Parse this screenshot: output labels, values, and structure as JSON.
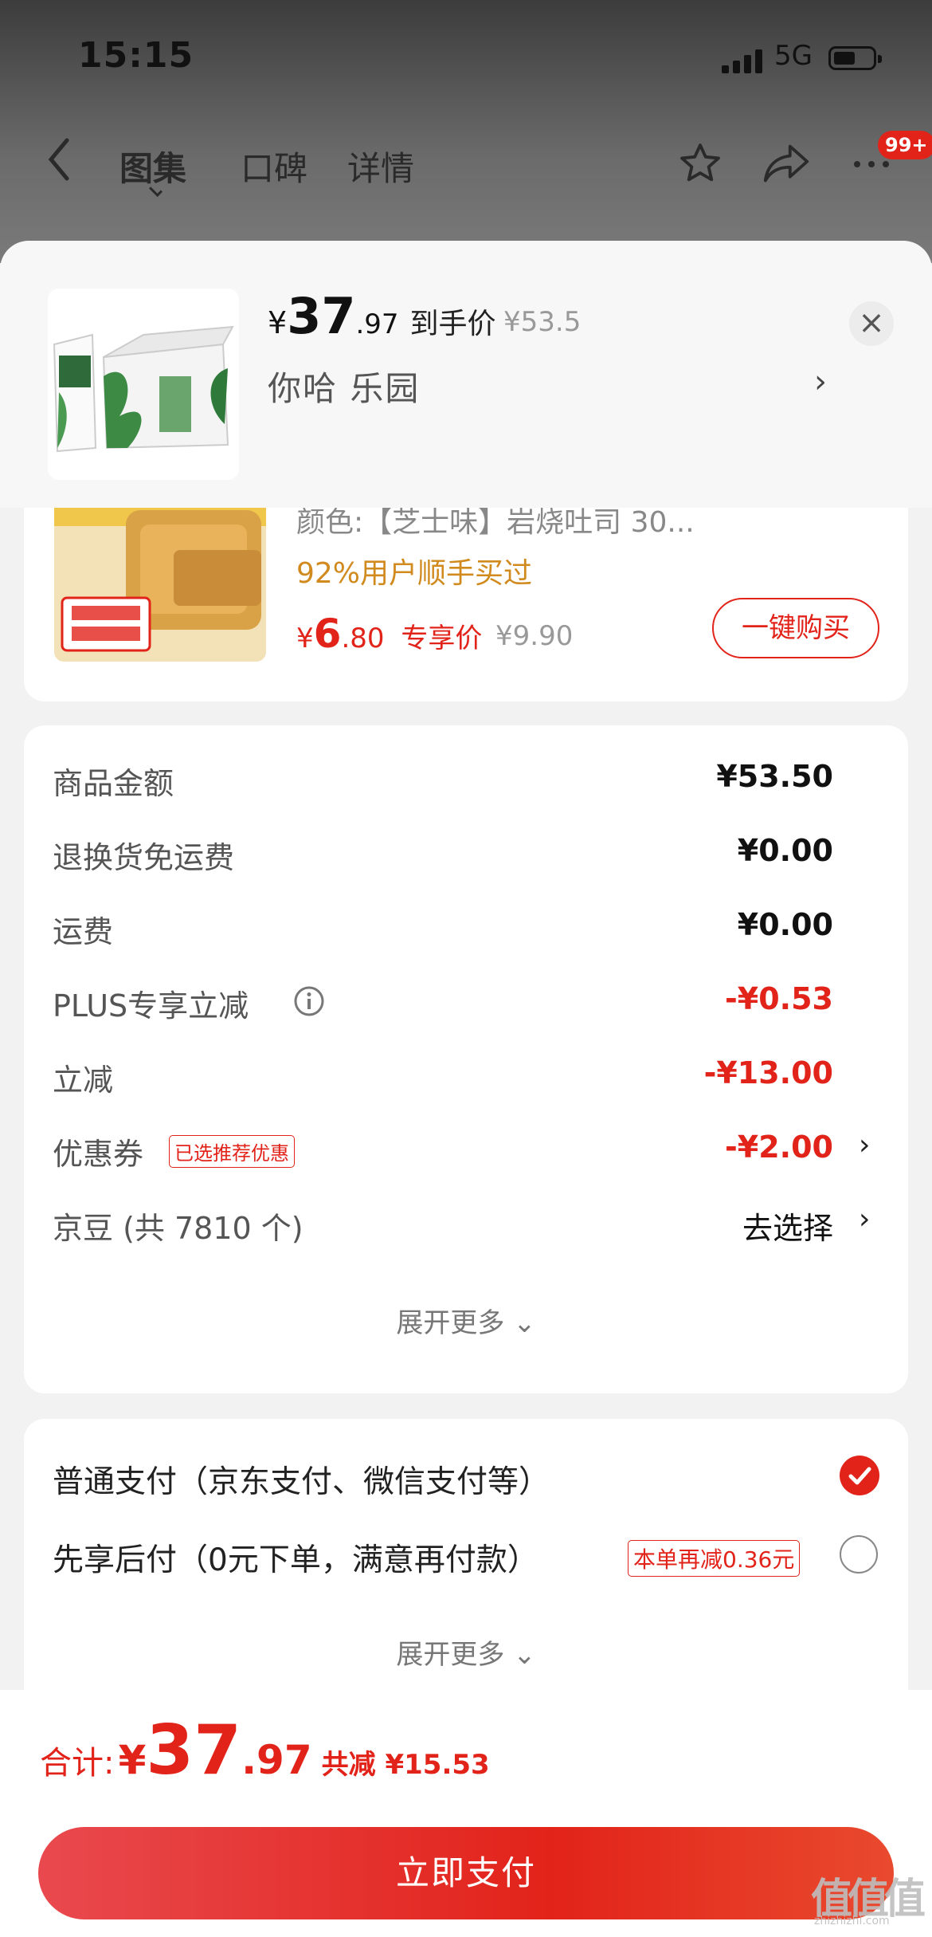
{
  "status_bar": {
    "time": "15:15",
    "network": "5G"
  },
  "nav": {
    "tabs": [
      "图集",
      "口碑",
      "详情"
    ],
    "back_icon": "back-arrow-icon",
    "star_icon": "star-icon",
    "share_icon": "share-icon",
    "more_icon": "more-icon",
    "badge": "99+"
  },
  "popup": {
    "currency": "¥",
    "price_int": "37",
    "price_dec": ".97",
    "price_tag": "到手价",
    "orig_price": "¥53.5",
    "spec": "你哈  乐园",
    "close_icon": "close-icon"
  },
  "addon": {
    "spec": "颜色:【芝士味】岩烧吐司 30...",
    "rate": "92%用户顺手买过",
    "currency": "¥",
    "price_int": "6",
    "price_dec": ".80",
    "price_tag": "专享价",
    "orig_price": "¥9.90",
    "buy_label": "一键购买"
  },
  "summary": {
    "rows": [
      {
        "label": "商品金额",
        "value": "¥53.50"
      },
      {
        "label": "退换货免运费",
        "value": "¥0.00"
      },
      {
        "label": "运费",
        "value": "¥0.00"
      },
      {
        "label": "PLUS专享立减",
        "value": "-¥0.53"
      },
      {
        "label": "立减",
        "value": "-¥13.00"
      },
      {
        "label": "优惠券",
        "value": "-¥2.00",
        "tag": "已选推荐优惠"
      },
      {
        "label": "京豆 (共 7810 个)",
        "value": "去选择"
      }
    ],
    "expand": "展开更多"
  },
  "payment": {
    "options": [
      {
        "label": "普通支付（京东支付、微信支付等）",
        "selected": true
      },
      {
        "label": "先享后付（0元下单，满意再付款）",
        "tag": "本单再减0.36元",
        "selected": false
      }
    ],
    "expand": "展开更多"
  },
  "footer": {
    "total_label": "合计:",
    "currency": "¥",
    "total_int": "37",
    "total_dec": ".97",
    "saved": "共减 ¥15.53",
    "pay_button": "立即支付"
  },
  "watermark": {
    "text": "值值值",
    "sub": "zhizhizhi.com"
  },
  "colors": {
    "accent": "#e2231a",
    "rate": "#d08a1e"
  }
}
